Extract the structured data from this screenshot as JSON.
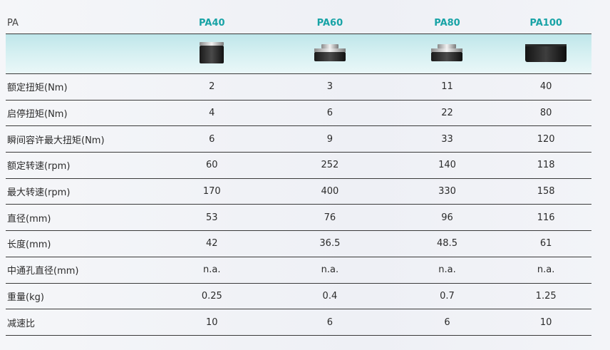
{
  "table": {
    "corner_label": "PA",
    "models": [
      "PA40",
      "PA60",
      "PA80",
      "PA100"
    ],
    "product_images": [
      "pa40-actuator-icon",
      "pa60-actuator-icon",
      "pa80-actuator-icon",
      "pa100-actuator-icon"
    ],
    "rows": [
      {
        "label": "额定扭矩(Nm)",
        "values": [
          "2",
          "3",
          "11",
          "40"
        ]
      },
      {
        "label": "启停扭矩(Nm)",
        "values": [
          "4",
          "6",
          "22",
          "80"
        ]
      },
      {
        "label": "瞬间容许最大扭矩(Nm)",
        "values": [
          "6",
          "9",
          "33",
          "120"
        ]
      },
      {
        "label": "额定转速(rpm)",
        "values": [
          "60",
          "252",
          "140",
          "118"
        ]
      },
      {
        "label": "最大转速(rpm)",
        "values": [
          "170",
          "400",
          "330",
          "158"
        ]
      },
      {
        "label": "直径(mm)",
        "values": [
          "53",
          "76",
          "96",
          "116"
        ]
      },
      {
        "label": "长度(mm)",
        "values": [
          "42",
          "36.5",
          "48.5",
          "61"
        ]
      },
      {
        "label": "中通孔直径(mm)",
        "values": [
          "n.a.",
          "n.a.",
          "n.a.",
          "n.a."
        ]
      },
      {
        "label": "重量(kg)",
        "values": [
          "0.25",
          "0.4",
          "0.7",
          "1.25"
        ]
      },
      {
        "label": "减速比",
        "values": [
          "10",
          "6",
          "6",
          "10"
        ]
      }
    ]
  },
  "colors": {
    "accent": "#18a3a6",
    "image_band": "#c9ebee",
    "divider": "#3a3a3a"
  }
}
